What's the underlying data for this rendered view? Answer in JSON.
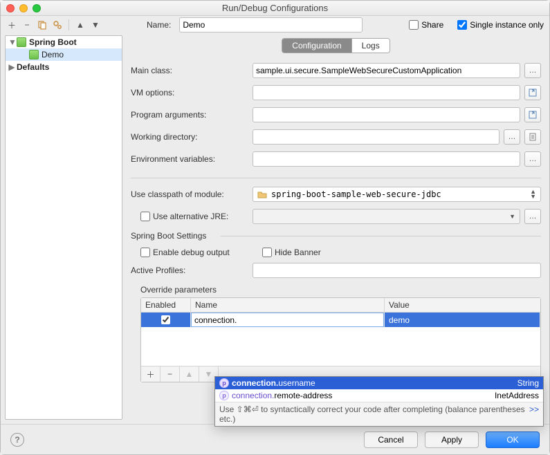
{
  "window": {
    "title": "Run/Debug Configurations"
  },
  "toolbar": {
    "add": "+",
    "remove": "−",
    "name_label": "Name:",
    "name_value": "Demo",
    "share_label": "Share",
    "share_checked": false,
    "single_label": "Single instance only",
    "single_checked": true
  },
  "tree": {
    "root1": "Spring Boot",
    "root1_child": "Demo",
    "root2": "Defaults"
  },
  "tabs": {
    "config": "Configuration",
    "logs": "Logs"
  },
  "fields": {
    "main_class_label": "Main class:",
    "main_class_value": "sample.ui.secure.SampleWebSecureCustomApplication",
    "vm_label": "VM options:",
    "vm_value": "",
    "args_label": "Program arguments:",
    "args_value": "",
    "wd_label": "Working directory:",
    "wd_value": "",
    "env_label": "Environment variables:",
    "env_value": "",
    "classpath_label": "Use classpath of module:",
    "classpath_value": "spring-boot-sample-web-secure-jdbc",
    "alt_jre_label": "Use alternative JRE:",
    "alt_jre_checked": false,
    "alt_jre_value": ""
  },
  "springboot": {
    "section": "Spring Boot Settings",
    "debug_label": "Enable debug output",
    "debug_checked": false,
    "hide_label": "Hide Banner",
    "hide_checked": false,
    "profiles_label": "Active Profiles:",
    "profiles_value": "",
    "override_label": "Override parameters",
    "cols": {
      "enabled": "Enabled",
      "name": "Name",
      "value": "Value"
    },
    "row": {
      "enabled": true,
      "name": "connection.",
      "value": "demo"
    }
  },
  "completion": {
    "opt1_match": "connection.",
    "opt1_rest": "username",
    "opt1_type": "String",
    "opt2_match": "connection.",
    "opt2_rest": "remote-address",
    "opt2_type": "InetAddress",
    "hint": "Use ⇧⌘⏎ to syntactically correct your code after completing (balance parentheses etc.)",
    "hint_link": ">>"
  },
  "footer": {
    "cancel": "Cancel",
    "apply": "Apply",
    "ok": "OK"
  }
}
